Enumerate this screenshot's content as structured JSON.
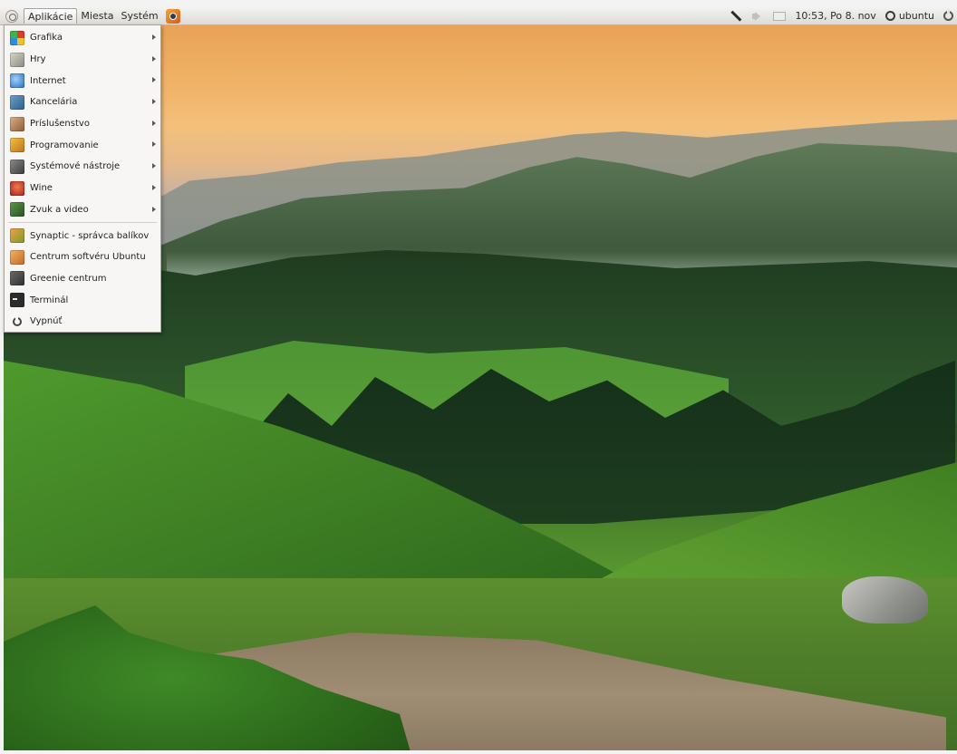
{
  "panel": {
    "menus": [
      {
        "label": "Aplikácie",
        "active": true
      },
      {
        "label": "Miesta",
        "active": false
      },
      {
        "label": "Systém",
        "active": false
      }
    ],
    "clock": "10:53, Po 8. nov",
    "user": "ubuntu",
    "icons": {
      "logo": "ubuntu-logo-icon",
      "launcher": "firefox-launcher-icon",
      "network": "network-pen-icon",
      "volume": "speaker-icon",
      "mail": "mail-icon",
      "user": "user-icon",
      "power": "power-icon"
    }
  },
  "app_menu": {
    "categories": [
      {
        "label": "Grafika",
        "icon": "graphics-icon"
      },
      {
        "label": "Hry",
        "icon": "games-icon"
      },
      {
        "label": "Internet",
        "icon": "internet-icon"
      },
      {
        "label": "Kancelária",
        "icon": "office-icon"
      },
      {
        "label": "Príslušenstvo",
        "icon": "accessories-icon"
      },
      {
        "label": "Programovanie",
        "icon": "programming-icon"
      },
      {
        "label": "Systémové nástroje",
        "icon": "system-tools-icon"
      },
      {
        "label": "Wine",
        "icon": "wine-icon"
      },
      {
        "label": "Zvuk a video",
        "icon": "sound-video-icon"
      }
    ],
    "launchers": [
      {
        "label": "Synaptic - správca balíkov",
        "icon": "synaptic-icon"
      },
      {
        "label": "Centrum softvéru Ubuntu",
        "icon": "software-center-icon"
      },
      {
        "label": "Greenie centrum",
        "icon": "greenie-icon"
      },
      {
        "label": "Terminál",
        "icon": "terminal-icon"
      },
      {
        "label": "Vypnúť",
        "icon": "power-icon"
      }
    ]
  }
}
